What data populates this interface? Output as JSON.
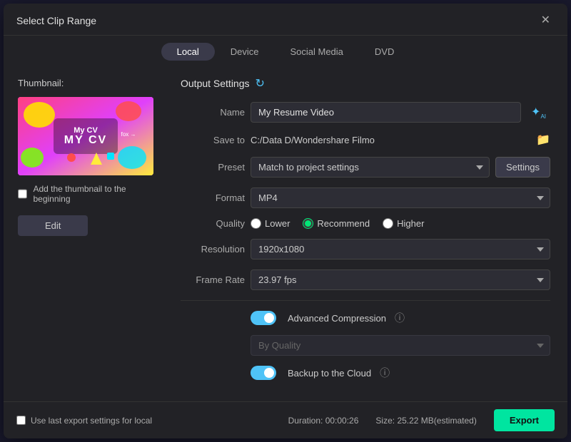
{
  "dialog": {
    "title": "Select Clip Range",
    "close_icon": "✕"
  },
  "tabs": [
    {
      "id": "local",
      "label": "Local",
      "active": true
    },
    {
      "id": "device",
      "label": "Device",
      "active": false
    },
    {
      "id": "social-media",
      "label": "Social Media",
      "active": false
    },
    {
      "id": "dvd",
      "label": "DVD",
      "active": false
    }
  ],
  "left_panel": {
    "thumbnail_label": "Thumbnail:",
    "thumbnail_text_my": "My CV",
    "add_checkbox_label": "Add the thumbnail to the beginning",
    "edit_button": "Edit"
  },
  "right_panel": {
    "output_settings_label": "Output Settings",
    "name_label": "Name",
    "name_value": "My Resume Video",
    "save_to_label": "Save to",
    "save_to_value": "C:/Data D/Wondershare Filmo",
    "preset_label": "Preset",
    "preset_value": "Match to project settings",
    "settings_button": "Settings",
    "format_label": "Format",
    "format_value": "MP4",
    "quality_label": "Quality",
    "quality_options": [
      {
        "id": "lower",
        "label": "Lower",
        "checked": false
      },
      {
        "id": "recommend",
        "label": "Recommend",
        "checked": true
      },
      {
        "id": "higher",
        "label": "Higher",
        "checked": false
      }
    ],
    "resolution_label": "Resolution",
    "resolution_value": "1920x1080",
    "frame_rate_label": "Frame Rate",
    "frame_rate_value": "23.97 fps",
    "advanced_compression_label": "Advanced Compression",
    "advanced_compression_enabled": true,
    "by_quality_placeholder": "By Quality",
    "backup_cloud_label": "Backup to the Cloud",
    "backup_cloud_enabled": true
  },
  "bottom_bar": {
    "use_last_label": "Use last export settings for local",
    "duration_label": "Duration:",
    "duration_value": "00:00:26",
    "size_label": "Size:",
    "size_value": "25.22 MB(estimated)",
    "export_button": "Export"
  }
}
